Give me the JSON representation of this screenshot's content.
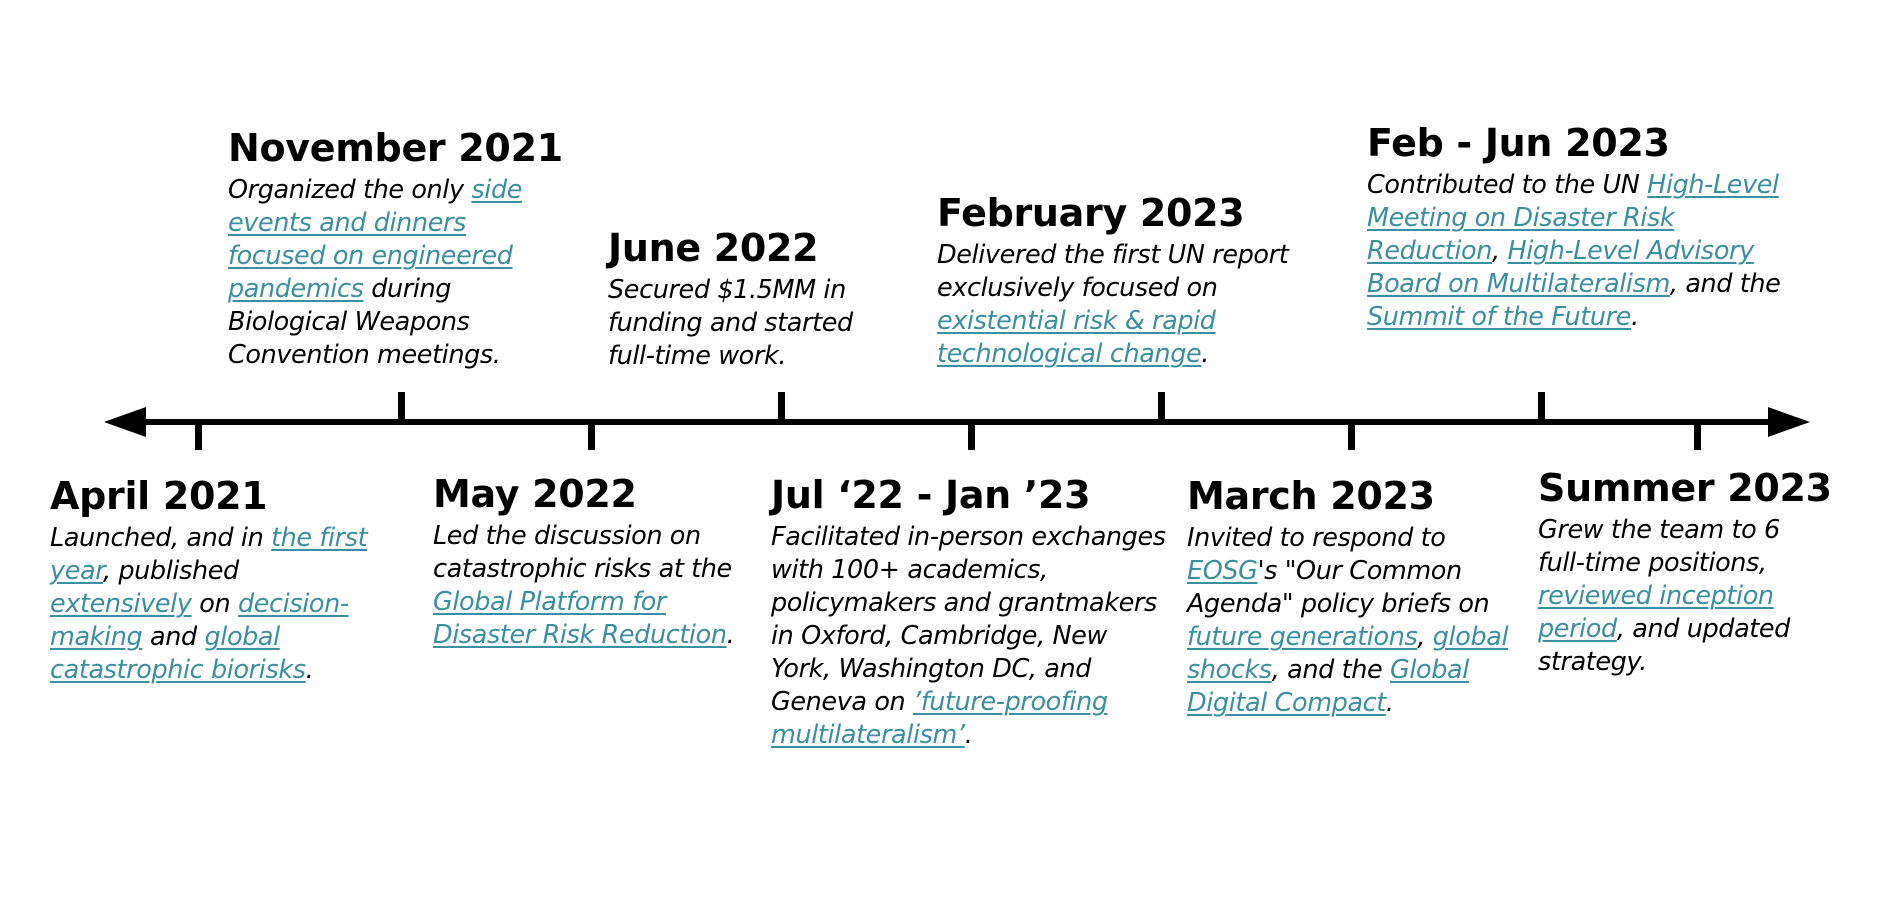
{
  "colors": {
    "line": "#000000",
    "link": "#3a8fa0",
    "text": "#000000",
    "spellcheck": "#d93b3b"
  },
  "events": [
    {
      "id": "apr-2021",
      "date": "April 2021",
      "parts": [
        {
          "t": "Launched, and in "
        },
        {
          "t": "the first year",
          "link": true
        },
        {
          "t": ", published "
        },
        {
          "t": "extensively",
          "link": true
        },
        {
          "t": " on "
        },
        {
          "t": "decision-making",
          "link": true
        },
        {
          "t": " and "
        },
        {
          "t": "global catastrophic biorisks",
          "link": true
        },
        {
          "t": "."
        }
      ]
    },
    {
      "id": "nov-2021",
      "date": "November 2021",
      "parts": [
        {
          "t": "Organized the only "
        },
        {
          "t": "side events and dinners focused on engineered pandemics",
          "link": true
        },
        {
          "t": " during Biological Weapons Convention meetings."
        }
      ]
    },
    {
      "id": "may-2022",
      "date": "May 2022",
      "parts": [
        {
          "t": "Led the discussion on catastrophic risks at the "
        },
        {
          "t": "Global Platform for Disaster Risk Reduction",
          "link": true
        },
        {
          "t": "."
        }
      ]
    },
    {
      "id": "jun-2022",
      "date": "June 2022",
      "parts": [
        {
          "t": "Secured $1.5MM in funding and started full-time work."
        }
      ]
    },
    {
      "id": "jul-22-jan-23",
      "date": "Jul ‘22 - Jan ’23",
      "parts": [
        {
          "t": "Facilitated in-person exchanges with 100+ academics, policymakers and grantmakers in Oxford, Cambridge, New York, Washington DC, and Geneva on "
        },
        {
          "t": "’future-proofing multilateralism’",
          "link": true
        },
        {
          "t": "."
        }
      ]
    },
    {
      "id": "feb-2023",
      "date": "February 2023",
      "parts": [
        {
          "t": "Delivered the first UN report exclusively focused on "
        },
        {
          "t": "existential risk & rapid technological change",
          "link": true
        },
        {
          "t": "."
        }
      ]
    },
    {
      "id": "mar-2023",
      "date": "March 2023",
      "parts": [
        {
          "t": "Invited to respond to "
        },
        {
          "t": "EOSG",
          "link": true,
          "squiggle": true
        },
        {
          "t": "'s \"Our Common Agenda\" policy briefs on "
        },
        {
          "t": "future generations",
          "link": true
        },
        {
          "t": ", "
        },
        {
          "t": "global shocks",
          "link": true
        },
        {
          "t": ", and the "
        },
        {
          "t": "Global Digital Compact",
          "link": true
        },
        {
          "t": "."
        }
      ]
    },
    {
      "id": "feb-jun-2023",
      "date": "Feb - Jun 2023",
      "parts": [
        {
          "t": "Contributed to the UN "
        },
        {
          "t": "High-Level Meeting on Disaster Risk Reduction",
          "link": true
        },
        {
          "t": ", "
        },
        {
          "t": "High-Level Advisory Board on Multilateralism",
          "link": true
        },
        {
          "t": ", and the "
        },
        {
          "t": "Summit of the Future",
          "link": true
        },
        {
          "t": "."
        }
      ]
    },
    {
      "id": "summer-2023",
      "date": "Summer 2023",
      "parts": [
        {
          "t": "Grew the team to 6 full-time positions, "
        },
        {
          "t": "reviewed inception period",
          "link": true
        },
        {
          "t": ", and updated strategy."
        }
      ]
    }
  ]
}
